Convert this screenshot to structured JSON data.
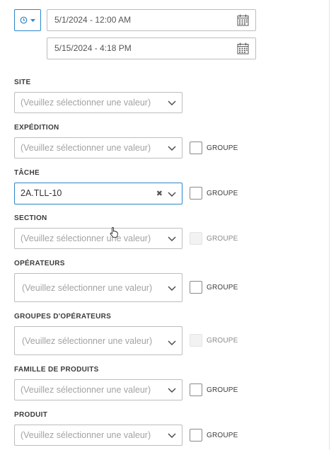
{
  "date_range": {
    "start": "5/1/2024 - 12:00 AM",
    "end": "5/15/2024 - 4:18 PM",
    "accent": "#2c86c9"
  },
  "placeholder": "(Veuillez sélectionner une valeur)",
  "group_label": "GROUPE",
  "filters": {
    "site": {
      "label": "SITE"
    },
    "expedition": {
      "label": "EXPÉDITION"
    },
    "tache": {
      "label": "TÂCHE",
      "value": "2A.TLL-10"
    },
    "section": {
      "label": "SECTION"
    },
    "operateurs": {
      "label": "OPÉRATEURS"
    },
    "groupes_operateurs": {
      "label": "GROUPES D'OPÉRATEURS"
    },
    "famille_produits": {
      "label": "FAMILLE DE PRODUITS"
    },
    "produit": {
      "label": "PRODUIT"
    }
  },
  "icons": {
    "clock": "clock-icon",
    "calendar": "calendar-icon",
    "chevron": "chevron-down-icon",
    "clear": "clear-icon",
    "cursor": "hand-cursor-icon"
  }
}
